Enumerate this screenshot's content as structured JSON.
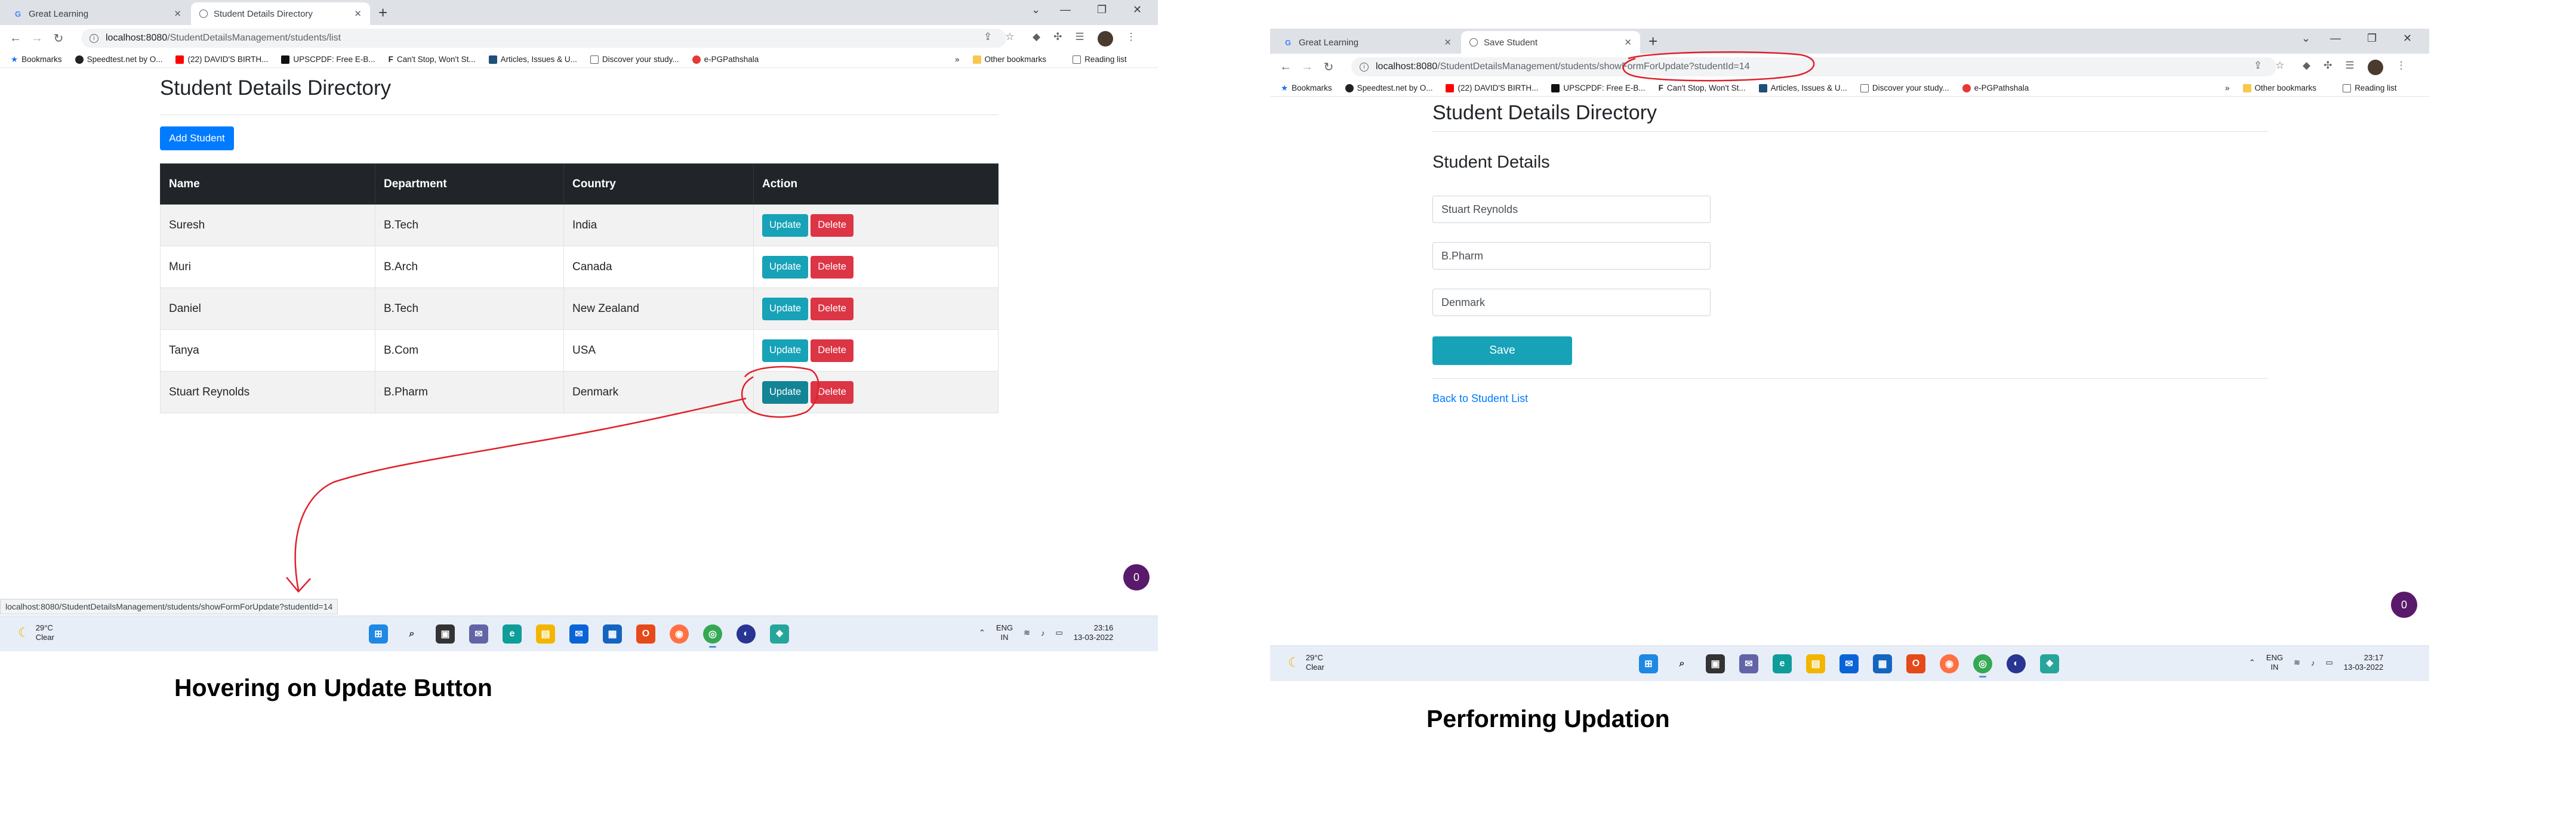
{
  "left": {
    "tabs": [
      {
        "label": "Great Learning",
        "favicon": "G"
      },
      {
        "label": "Student Details Directory",
        "favicon": "globe"
      }
    ],
    "url_host": "localhost:8080",
    "url_path": "/StudentDetailsManagement/students/list",
    "bookmarks": [
      "Bookmarks",
      "Speedtest.net by O...",
      "(22) DAVID'S BIRTH...",
      "UPSCPDF: Free E-B...",
      "Can't Stop, Won't St...",
      "Articles, Issues & U...",
      "Discover your study...",
      "e-PGPathshala"
    ],
    "bookmarks_right": [
      "Other bookmarks",
      "Reading list"
    ],
    "heading": "Student Details Directory",
    "add_button": "Add Student",
    "columns": [
      "Name",
      "Department",
      "Country",
      "Action"
    ],
    "rows": [
      {
        "name": "Suresh",
        "department": "B.Tech",
        "country": "India"
      },
      {
        "name": "Muri",
        "department": "B.Arch",
        "country": "Canada"
      },
      {
        "name": "Daniel",
        "department": "B.Tech",
        "country": "New Zealand"
      },
      {
        "name": "Tanya",
        "department": "B.Com",
        "country": "USA"
      },
      {
        "name": "Stuart Reynolds",
        "department": "B.Pharm",
        "country": "Denmark"
      }
    ],
    "update_label": "Update",
    "delete_label": "Delete",
    "status_url": "localhost:8080/StudentDetailsManagement/students/showFormForUpdate?studentId=14",
    "badge": "0",
    "weather_temp": "29°C",
    "weather_desc": "Clear",
    "lang_1": "ENG",
    "lang_2": "IN",
    "time": "23:16",
    "date": "13-03-2022",
    "caption": "Hovering on Update Button"
  },
  "right": {
    "tabs": [
      {
        "label": "Great Learning",
        "favicon": "G"
      },
      {
        "label": "Save Student",
        "favicon": "globe"
      }
    ],
    "url_host": "localhost:8080",
    "url_path": "/StudentDetailsManagement/students/showFormForUpdate?studentId=14",
    "bookmarks": [
      "Bookmarks",
      "Speedtest.net by O...",
      "(22) DAVID'S BIRTH...",
      "UPSCPDF: Free E-B...",
      "Can't Stop, Won't St...",
      "Articles, Issues & U...",
      "Discover your study...",
      "e-PGPathshala"
    ],
    "bookmarks_right": [
      "Other bookmarks",
      "Reading list"
    ],
    "heading": "Student Details Directory",
    "section": "Student Details",
    "field_name": "Stuart Reynolds",
    "field_department": "B.Pharm",
    "field_country": "Denmark",
    "save_label": "Save",
    "back_link": "Back to Student List",
    "badge": "0",
    "weather_temp": "29°C",
    "weather_desc": "Clear",
    "lang_1": "ENG",
    "lang_2": "IN",
    "time": "23:17",
    "date": "13-03-2022",
    "caption": "Performing Updation"
  },
  "colors": {
    "primary": "#007bff",
    "info": "#17a2b8",
    "danger": "#dc3545",
    "table_header": "#212529",
    "annotation": "#e0202a",
    "badge": "#5a1a6b"
  }
}
